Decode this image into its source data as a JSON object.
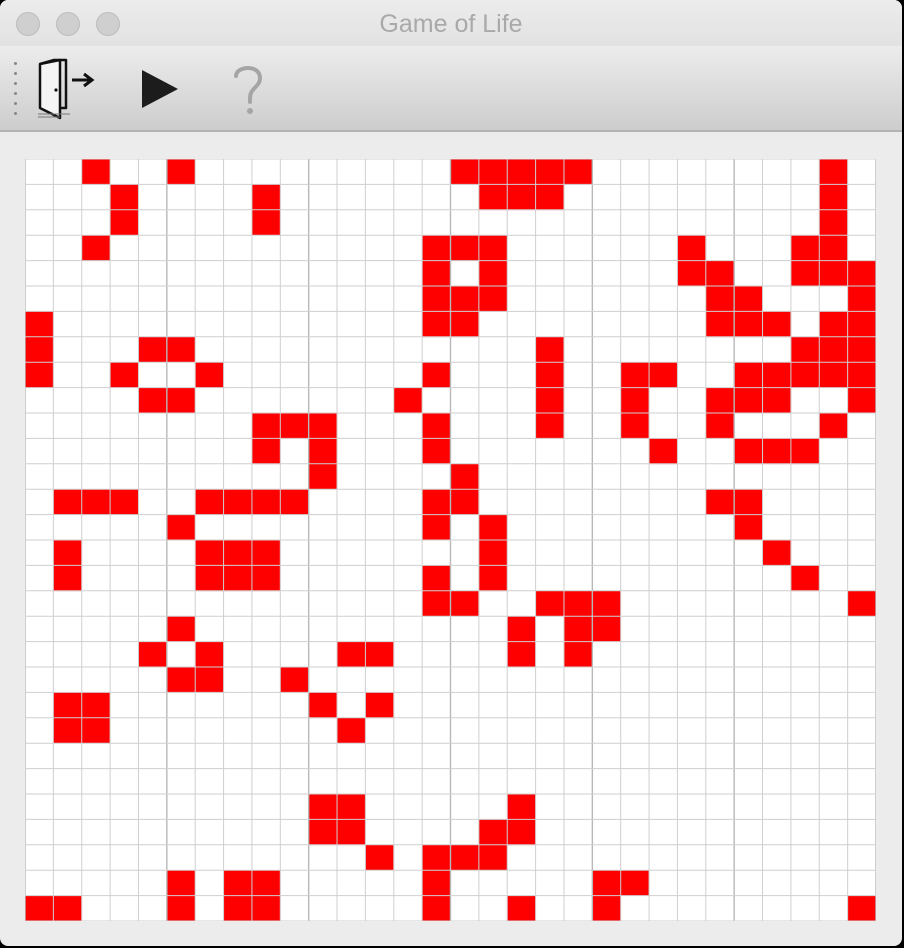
{
  "window": {
    "title": "Game of Life"
  },
  "titlebar": {
    "buttons": [
      {
        "name": "close-button"
      },
      {
        "name": "minimize-button"
      },
      {
        "name": "zoom-button"
      }
    ]
  },
  "toolbar": {
    "items": [
      {
        "name": "exit-button",
        "icon": "exit-door-icon"
      },
      {
        "name": "play-button",
        "icon": "play-icon"
      },
      {
        "name": "help-button",
        "icon": "help-question-icon",
        "enabled": false
      }
    ]
  },
  "board": {
    "columns": 30,
    "rows": 30,
    "colors": {
      "alive": "#ff0000",
      "dead": "#ffffff",
      "grid": "#cfcfcf",
      "major_grid": "#b8b8b8"
    },
    "major_line_every": 5,
    "alive_cells": [
      [
        0,
        2
      ],
      [
        0,
        5
      ],
      [
        0,
        15
      ],
      [
        0,
        16
      ],
      [
        0,
        17
      ],
      [
        0,
        18
      ],
      [
        0,
        19
      ],
      [
        0,
        28
      ],
      [
        1,
        3
      ],
      [
        1,
        8
      ],
      [
        1,
        16
      ],
      [
        1,
        17
      ],
      [
        1,
        18
      ],
      [
        1,
        28
      ],
      [
        2,
        3
      ],
      [
        2,
        8
      ],
      [
        2,
        28
      ],
      [
        3,
        2
      ],
      [
        3,
        14
      ],
      [
        3,
        15
      ],
      [
        3,
        16
      ],
      [
        3,
        23
      ],
      [
        3,
        27
      ],
      [
        3,
        28
      ],
      [
        4,
        14
      ],
      [
        4,
        16
      ],
      [
        4,
        23
      ],
      [
        4,
        24
      ],
      [
        4,
        27
      ],
      [
        4,
        28
      ],
      [
        4,
        29
      ],
      [
        5,
        14
      ],
      [
        5,
        15
      ],
      [
        5,
        16
      ],
      [
        5,
        24
      ],
      [
        5,
        25
      ],
      [
        5,
        29
      ],
      [
        6,
        0
      ],
      [
        6,
        14
      ],
      [
        6,
        15
      ],
      [
        6,
        24
      ],
      [
        6,
        25
      ],
      [
        6,
        26
      ],
      [
        6,
        28
      ],
      [
        6,
        29
      ],
      [
        7,
        0
      ],
      [
        7,
        4
      ],
      [
        7,
        5
      ],
      [
        7,
        18
      ],
      [
        7,
        27
      ],
      [
        7,
        28
      ],
      [
        7,
        29
      ],
      [
        8,
        0
      ],
      [
        8,
        3
      ],
      [
        8,
        6
      ],
      [
        8,
        14
      ],
      [
        8,
        18
      ],
      [
        8,
        21
      ],
      [
        8,
        22
      ],
      [
        8,
        25
      ],
      [
        8,
        26
      ],
      [
        8,
        27
      ],
      [
        8,
        28
      ],
      [
        8,
        29
      ],
      [
        9,
        4
      ],
      [
        9,
        5
      ],
      [
        9,
        13
      ],
      [
        9,
        18
      ],
      [
        9,
        21
      ],
      [
        9,
        24
      ],
      [
        9,
        25
      ],
      [
        9,
        26
      ],
      [
        9,
        29
      ],
      [
        10,
        8
      ],
      [
        10,
        9
      ],
      [
        10,
        10
      ],
      [
        10,
        14
      ],
      [
        10,
        18
      ],
      [
        10,
        21
      ],
      [
        10,
        24
      ],
      [
        10,
        28
      ],
      [
        11,
        8
      ],
      [
        11,
        10
      ],
      [
        11,
        14
      ],
      [
        11,
        22
      ],
      [
        11,
        25
      ],
      [
        11,
        26
      ],
      [
        11,
        27
      ],
      [
        12,
        10
      ],
      [
        12,
        15
      ],
      [
        13,
        1
      ],
      [
        13,
        2
      ],
      [
        13,
        3
      ],
      [
        13,
        6
      ],
      [
        13,
        7
      ],
      [
        13,
        8
      ],
      [
        13,
        9
      ],
      [
        13,
        14
      ],
      [
        13,
        15
      ],
      [
        13,
        24
      ],
      [
        13,
        25
      ],
      [
        14,
        5
      ],
      [
        14,
        14
      ],
      [
        14,
        16
      ],
      [
        14,
        25
      ],
      [
        15,
        1
      ],
      [
        15,
        6
      ],
      [
        15,
        7
      ],
      [
        15,
        8
      ],
      [
        15,
        16
      ],
      [
        15,
        26
      ],
      [
        16,
        1
      ],
      [
        16,
        6
      ],
      [
        16,
        7
      ],
      [
        16,
        8
      ],
      [
        16,
        14
      ],
      [
        16,
        16
      ],
      [
        16,
        27
      ],
      [
        17,
        14
      ],
      [
        17,
        15
      ],
      [
        17,
        18
      ],
      [
        17,
        19
      ],
      [
        17,
        20
      ],
      [
        17,
        29
      ],
      [
        18,
        5
      ],
      [
        18,
        17
      ],
      [
        18,
        19
      ],
      [
        18,
        20
      ],
      [
        19,
        4
      ],
      [
        19,
        6
      ],
      [
        19,
        11
      ],
      [
        19,
        12
      ],
      [
        19,
        17
      ],
      [
        19,
        19
      ],
      [
        20,
        5
      ],
      [
        20,
        6
      ],
      [
        20,
        9
      ],
      [
        21,
        1
      ],
      [
        21,
        2
      ],
      [
        21,
        10
      ],
      [
        21,
        12
      ],
      [
        22,
        1
      ],
      [
        22,
        2
      ],
      [
        22,
        11
      ],
      [
        25,
        10
      ],
      [
        25,
        11
      ],
      [
        25,
        17
      ],
      [
        26,
        10
      ],
      [
        26,
        11
      ],
      [
        26,
        16
      ],
      [
        26,
        17
      ],
      [
        27,
        12
      ],
      [
        27,
        14
      ],
      [
        27,
        15
      ],
      [
        27,
        16
      ],
      [
        28,
        5
      ],
      [
        28,
        7
      ],
      [
        28,
        8
      ],
      [
        28,
        14
      ],
      [
        28,
        20
      ],
      [
        28,
        21
      ],
      [
        29,
        0
      ],
      [
        29,
        1
      ],
      [
        29,
        5
      ],
      [
        29,
        7
      ],
      [
        29,
        8
      ],
      [
        29,
        14
      ],
      [
        29,
        17
      ],
      [
        29,
        20
      ],
      [
        29,
        29
      ]
    ]
  }
}
